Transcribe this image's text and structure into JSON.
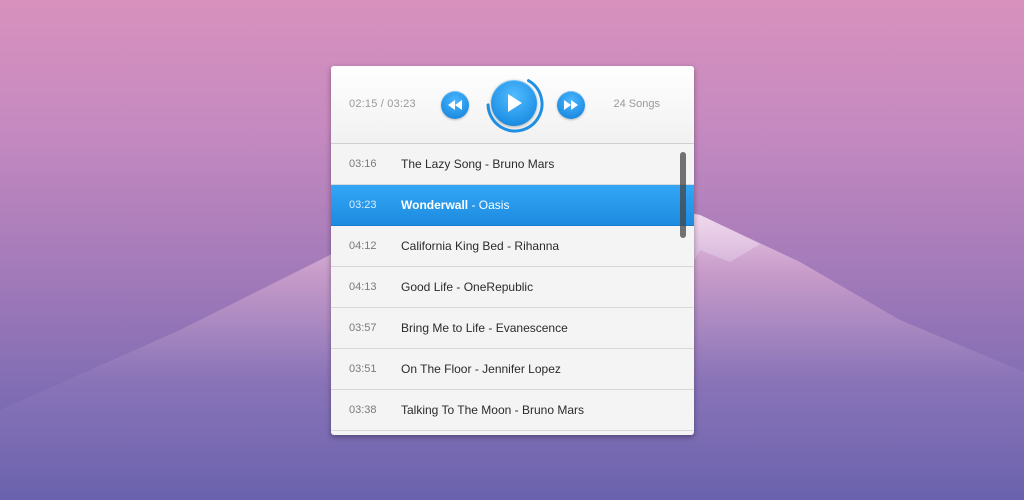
{
  "player": {
    "time": "02:15 / 03:23",
    "song_count": "24 Songs",
    "progress": 0.66,
    "accent": "#1f8fe3",
    "icons": {
      "rewind": "rewind-icon",
      "play": "play-icon",
      "fast_forward": "fast-forward-icon"
    }
  },
  "playlist": {
    "active_index": 1,
    "tracks": [
      {
        "duration": "03:16",
        "title": "The Lazy Song",
        "artist": "Bruno Mars"
      },
      {
        "duration": "03:23",
        "title": "Wonderwall",
        "artist": "Oasis"
      },
      {
        "duration": "04:12",
        "title": "California King Bed",
        "artist": "Rihanna"
      },
      {
        "duration": "04:13",
        "title": "Good Life",
        "artist": "OneRepublic"
      },
      {
        "duration": "03:57",
        "title": "Bring Me to Life",
        "artist": "Evanescence"
      },
      {
        "duration": "03:51",
        "title": "On The Floor",
        "artist": "Jennifer Lopez"
      },
      {
        "duration": "03:38",
        "title": "Talking To The Moon",
        "artist": "Bruno Mars"
      }
    ]
  }
}
